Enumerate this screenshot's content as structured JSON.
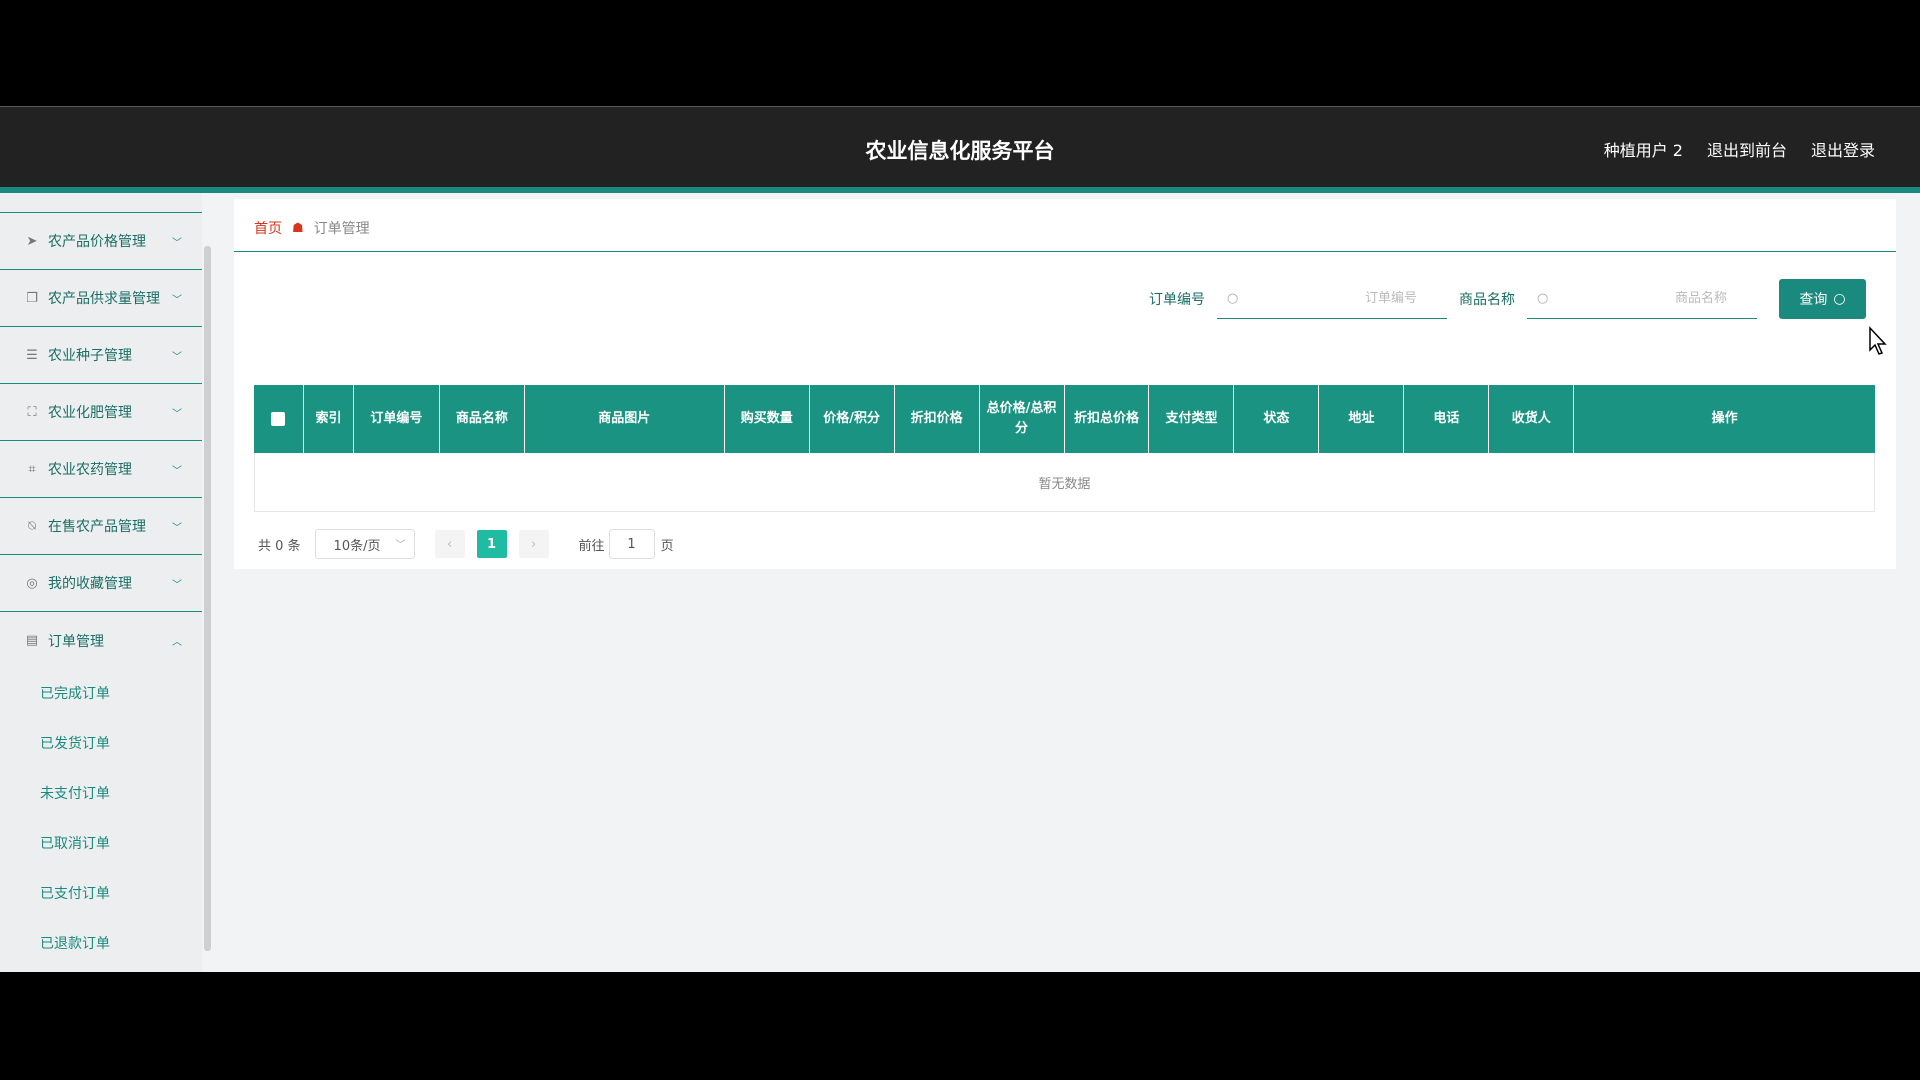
{
  "header": {
    "title": "农业信息化服务平台",
    "user": "种植用户 2",
    "exit_front": "退出到前台",
    "logout": "退出登录"
  },
  "sidebar": {
    "items": [
      {
        "label": "农产品价格管理",
        "icon": "send-icon"
      },
      {
        "label": "农产品供求量管理",
        "icon": "copy-icon"
      },
      {
        "label": "农业种子管理",
        "icon": "sliders-icon"
      },
      {
        "label": "农业化肥管理",
        "icon": "fullscreen-icon"
      },
      {
        "label": "农业农药管理",
        "icon": "crop-icon"
      },
      {
        "label": "在售农产品管理",
        "icon": "bell-off-icon"
      },
      {
        "label": "我的收藏管理",
        "icon": "compass-icon"
      },
      {
        "label": "订单管理",
        "icon": "clipboard-icon"
      }
    ],
    "sub_items": [
      "已完成订单",
      "已发货订单",
      "未支付订单",
      "已取消订单",
      "已支付订单",
      "已退款订单"
    ]
  },
  "breadcrumb": {
    "home": "首页",
    "current": "订单管理"
  },
  "search": {
    "order_no_label": "订单编号",
    "order_no_placeholder": "订单编号",
    "goods_name_label": "商品名称",
    "goods_name_placeholder": "商品名称",
    "query_button": "查询"
  },
  "table": {
    "columns": [
      "索引",
      "订单编号",
      "商品名称",
      "商品图片",
      "购买数量",
      "价格/积分",
      "折扣价格",
      "总价格/总积分",
      "折扣总价格",
      "支付类型",
      "状态",
      "地址",
      "电话",
      "收货人",
      "操作"
    ],
    "empty_text": "暂无数据"
  },
  "pagination": {
    "total": "共 0 条",
    "page_size": "10条/页",
    "current_page": "1",
    "goto_label": "前往",
    "goto_value": "1",
    "page_suffix": "页"
  },
  "colors": {
    "accent": "#1a8a7e",
    "header_bg": "#222222",
    "table_header": "#1a9382"
  }
}
